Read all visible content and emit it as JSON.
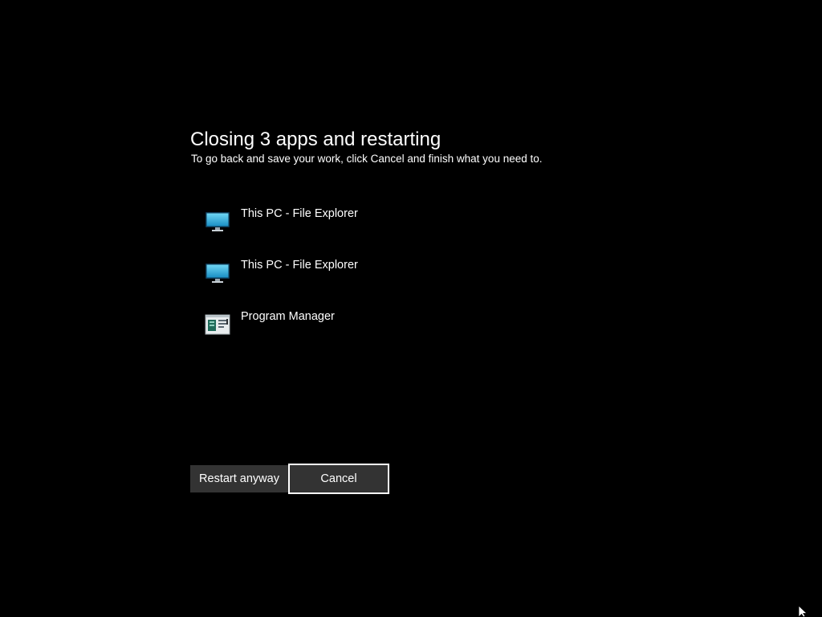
{
  "dialog": {
    "title": "Closing 3 apps and restarting",
    "subtitle": "To go back and save your work, click Cancel and finish what you need to."
  },
  "apps": [
    {
      "label": "This PC - File Explorer",
      "icon": "monitor-icon"
    },
    {
      "label": "This PC - File Explorer",
      "icon": "monitor-icon"
    },
    {
      "label": "Program Manager",
      "icon": "program-manager-icon"
    }
  ],
  "buttons": {
    "restart_label": "Restart anyway",
    "cancel_label": "Cancel"
  },
  "colors": {
    "background": "#000000",
    "text": "#ffffff",
    "button_bg": "#333333",
    "focus_border": "#ffffff",
    "monitor_screen": "#2fb6e0"
  }
}
